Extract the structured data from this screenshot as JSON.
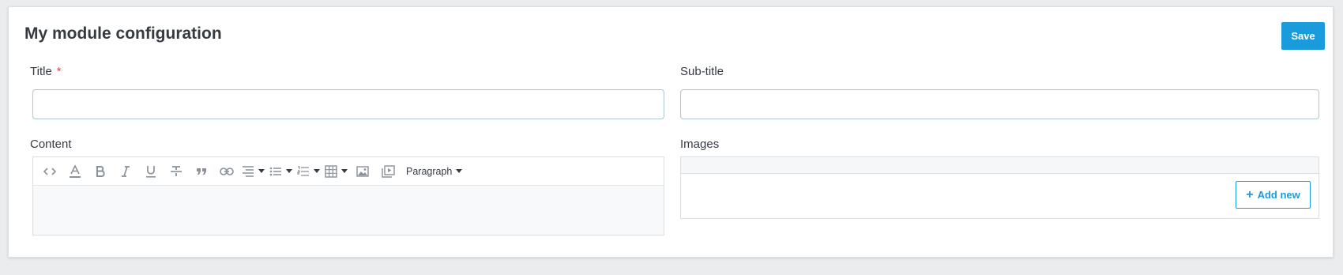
{
  "header": {
    "title": "My module configuration",
    "save_label": "Save"
  },
  "fields": {
    "title": {
      "label": "Title",
      "required_mark": "*",
      "value": "",
      "placeholder": ""
    },
    "subtitle": {
      "label": "Sub-title",
      "value": "",
      "placeholder": ""
    },
    "content": {
      "label": "Content",
      "format_label": "Paragraph"
    },
    "images": {
      "label": "Images",
      "add_label": "Add new",
      "add_icon": "+"
    }
  },
  "toolbar_icons": [
    "code-icon",
    "text-color-icon",
    "bold-icon",
    "italic-icon",
    "underline-icon",
    "strikethrough-icon",
    "quote-icon",
    "link-icon",
    "align-icon",
    "bullet-list-icon",
    "numbered-list-icon",
    "table-icon",
    "image-icon",
    "media-icon"
  ],
  "colors": {
    "accent": "#1a9bdb",
    "required": "#e0483e",
    "background": "#ebeced"
  }
}
